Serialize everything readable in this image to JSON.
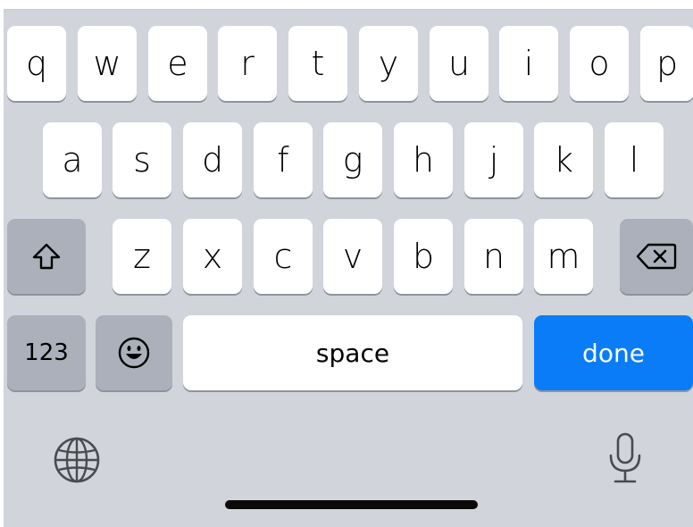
{
  "keyboard": {
    "row1": [
      "q",
      "w",
      "e",
      "r",
      "t",
      "y",
      "u",
      "i",
      "o",
      "p"
    ],
    "row2": [
      "a",
      "s",
      "d",
      "f",
      "g",
      "h",
      "j",
      "k",
      "l"
    ],
    "row3": [
      "z",
      "x",
      "c",
      "v",
      "b",
      "n",
      "m"
    ],
    "numbers_label": "123",
    "space_label": "space",
    "done_label": "done",
    "icons": {
      "shift": "shift-icon",
      "delete": "delete-icon",
      "emoji": "emoji-icon",
      "globe": "globe-icon",
      "microphone": "microphone-icon"
    },
    "colors": {
      "background": "#d1d4da",
      "key": "#ffffff",
      "function_key": "#abb0ba",
      "action_key": "#0a7cf7",
      "home_indicator": "#0a0a0a"
    }
  }
}
